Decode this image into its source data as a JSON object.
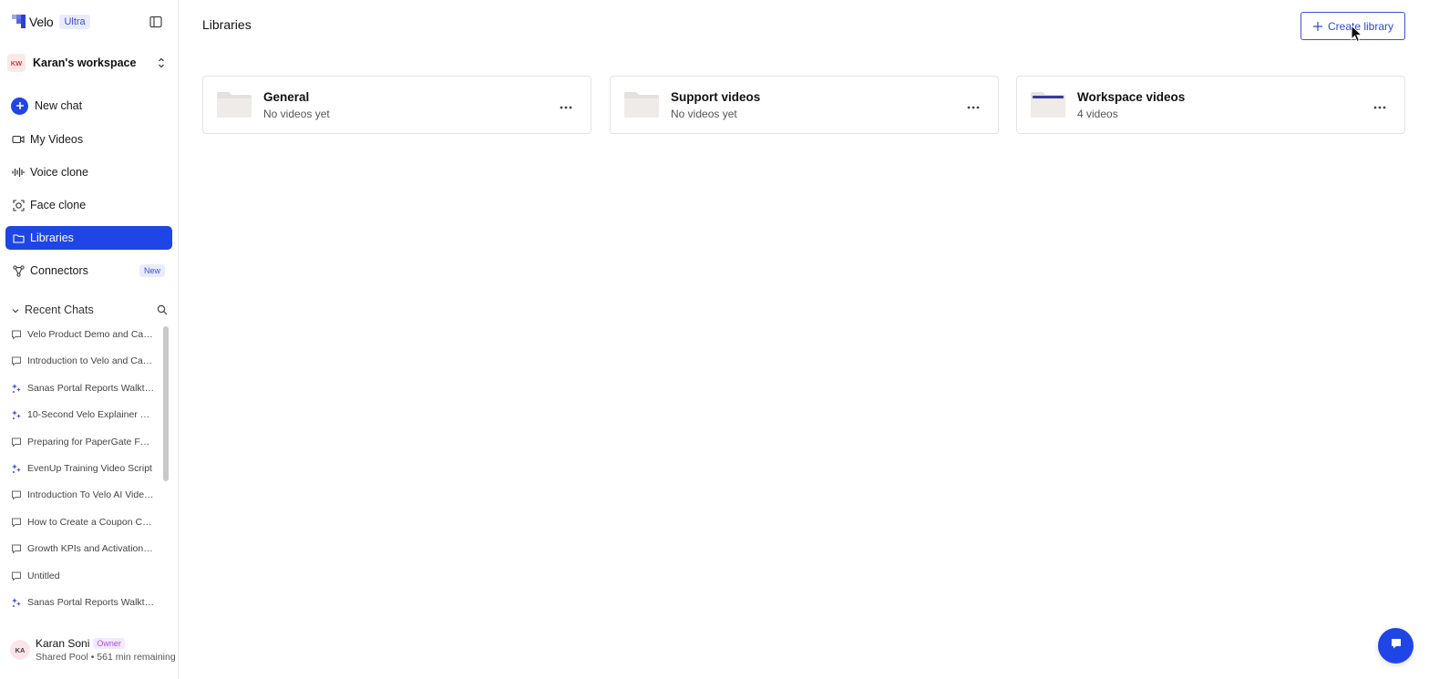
{
  "brand": {
    "name": "Velo",
    "plan": "Ultra"
  },
  "workspace": {
    "initials": "KW",
    "name": "Karan's workspace"
  },
  "nav": {
    "new_chat": "New chat",
    "my_videos": "My Videos",
    "voice_clone": "Voice clone",
    "face_clone": "Face clone",
    "libraries": "Libraries",
    "connectors": "Connectors",
    "connectors_badge": "New"
  },
  "recent": {
    "title": "Recent Chats",
    "items": [
      {
        "label": "Velo Product Demo and Caps...",
        "icon": "chat-bubble-icon"
      },
      {
        "label": "Introduction to Velo and Caps...",
        "icon": "chat-bubble-icon"
      },
      {
        "label": "Sanas Portal Reports Walkthr...",
        "icon": "sparkle-icon"
      },
      {
        "label": "10-Second Velo Explainer Vid...",
        "icon": "sparkle-icon"
      },
      {
        "label": "Preparing for PaperGate Full-...",
        "icon": "chat-bubble-icon"
      },
      {
        "label": "EvenUp Training Video Script",
        "icon": "sparkle-icon"
      },
      {
        "label": "Introduction To Velo AI Video ...",
        "icon": "chat-bubble-icon"
      },
      {
        "label": "How to Create a Coupon Cod...",
        "icon": "chat-bubble-icon"
      },
      {
        "label": "Growth KPIs and Activation F...",
        "icon": "chat-bubble-icon"
      },
      {
        "label": "Untitled",
        "icon": "chat-bubble-icon"
      },
      {
        "label": "Sanas Portal Reports Walkthr...",
        "icon": "sparkle-icon"
      }
    ]
  },
  "user": {
    "initials": "KA",
    "name": "Karan Soni",
    "role": "Owner",
    "usage": "Shared Pool • 561 min remaining"
  },
  "main": {
    "title": "Libraries",
    "create_button": "Create library",
    "libraries": [
      {
        "name": "General",
        "count": "No videos yet"
      },
      {
        "name": "Support videos",
        "count": "No videos yet"
      },
      {
        "name": "Workspace videos",
        "count": "4 videos"
      }
    ]
  },
  "colors": {
    "accent": "#1f45e6",
    "border": "#e3e3e3"
  }
}
